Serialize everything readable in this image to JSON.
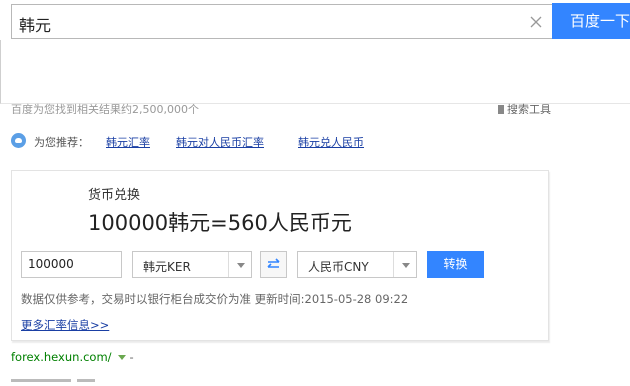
{
  "search": {
    "query": "韩元",
    "button_label": "百度一下",
    "clear_icon": "close-icon"
  },
  "results": {
    "count_text": "百度为您找到相关结果约2,500,000个",
    "tools_label": "搜索工具"
  },
  "recommend": {
    "label": "为您推荐：",
    "links": [
      "韩元汇率",
      "韩元对人民币汇率",
      "韩元兑人民币"
    ]
  },
  "converter": {
    "title": "货币兑换",
    "result": "100000韩元=560人民币元",
    "amount": "100000",
    "from_currency": "韩元KER",
    "to_currency": "人民币CNY",
    "convert_label": "转换",
    "note": "数据仅供参考，交易时以银行柜台成交价为准 更新时间:2015-05-28 09:22",
    "more_link": "更多汇率信息>>"
  },
  "source": {
    "url": "forex.hexun.com/",
    "dash": "-"
  },
  "colors": {
    "accent": "#3385ff",
    "link": "#1a3fa4",
    "url": "#008000"
  }
}
